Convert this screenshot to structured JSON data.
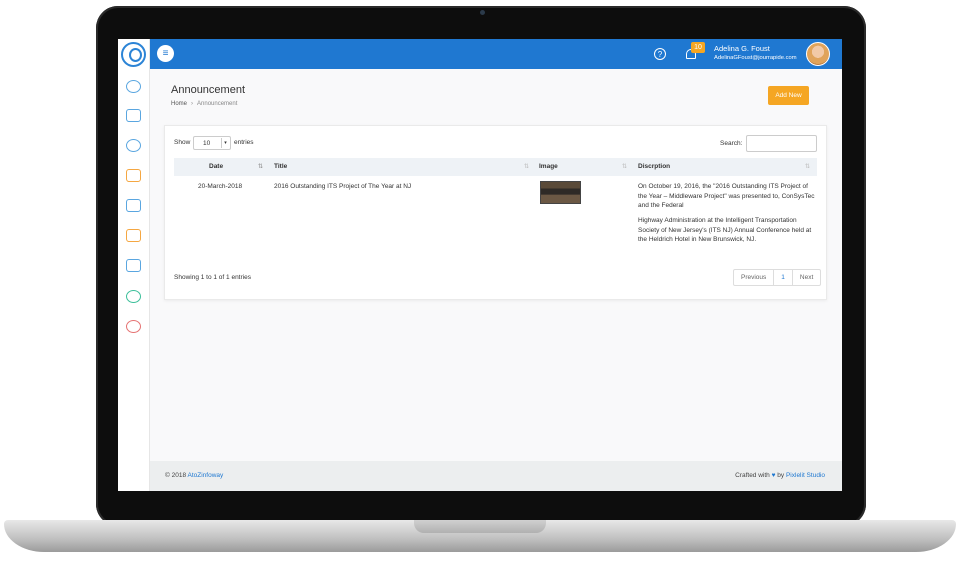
{
  "topbar": {
    "notification_count": "10",
    "user_name": "Adelina G. Foust",
    "user_email": "AdelinaGFoust@jourrapide.com"
  },
  "page": {
    "title": "Announcement",
    "breadcrumb": [
      "Home",
      "Announcement"
    ],
    "breadcrumb_separator": "›",
    "add_button": "Add New"
  },
  "table_controls": {
    "show_label": "Show",
    "entries_value": "10",
    "entries_label": "entries",
    "search_label": "Search:",
    "search_value": ""
  },
  "table": {
    "columns": [
      "Date",
      "Title",
      "Image",
      "Discrption"
    ],
    "rows": [
      {
        "date": "20-March-2018",
        "title": "2016 Outstanding ITS Project of The Year at NJ",
        "description_p1": "On October 19, 2016, the \"2016 Outstanding ITS Project of the Year – Middleware Project\" was presented to, ConSysTec and the Federal",
        "description_p2": "Highway Administration at the Intelligent Transportation Society of New Jersey's (ITS NJ) Annual Conference held at the Heldrich Hotel in New Brunswick, NJ."
      }
    ]
  },
  "pagination": {
    "info": "Showing 1 to 1 of 1 entries",
    "previous": "Previous",
    "current": "1",
    "next": "Next"
  },
  "footer": {
    "copyright_prefix": "© 2018",
    "company": "AtoZinfoway",
    "crafted_prefix": "Crafted with",
    "crafted_by": "by",
    "studio": "Pixlelit Studio"
  },
  "colors": {
    "primary": "#1f78d1",
    "accent": "#f5a623"
  }
}
